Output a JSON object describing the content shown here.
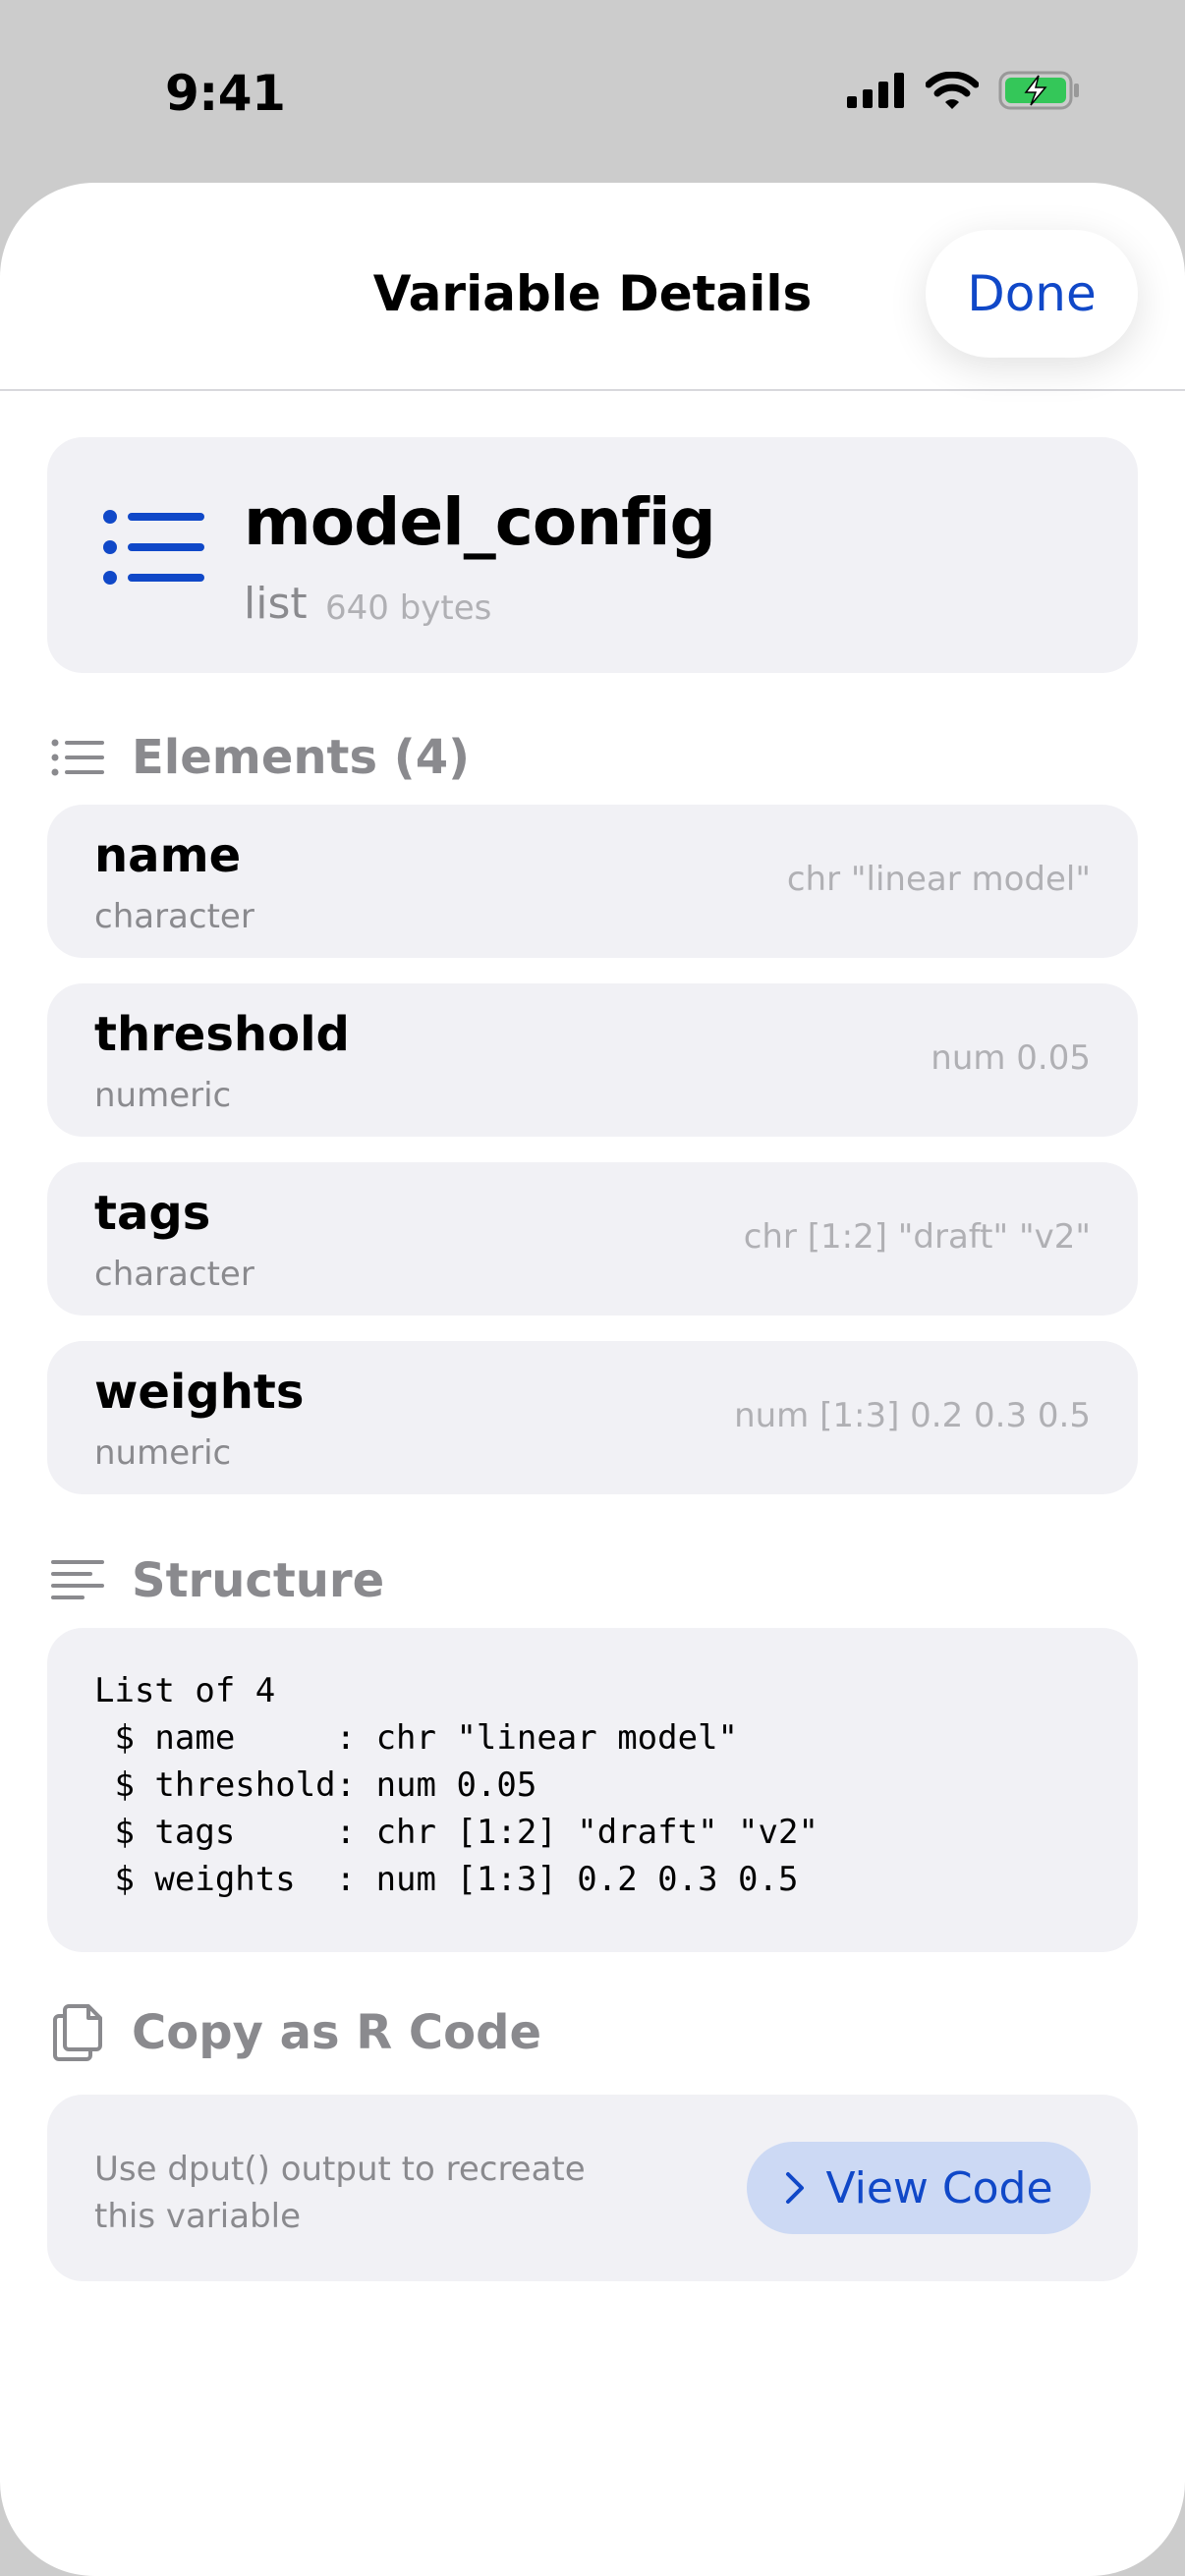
{
  "status_bar": {
    "time": "9:41"
  },
  "nav": {
    "title": "Variable Details",
    "done_label": "Done"
  },
  "variable": {
    "name": "model_config",
    "type": "list",
    "size": "640 bytes"
  },
  "elements_section": {
    "title": "Elements (4)"
  },
  "elements": [
    {
      "name": "name",
      "type": "character",
      "value": "chr \"linear model\""
    },
    {
      "name": "threshold",
      "type": "numeric",
      "value": "num 0.05"
    },
    {
      "name": "tags",
      "type": "character",
      "value": "chr [1:2] \"draft\" \"v2\""
    },
    {
      "name": "weights",
      "type": "numeric",
      "value": "num [1:3] 0.2 0.3 0.5"
    }
  ],
  "structure_section": {
    "title": "Structure",
    "lines": [
      "List of 4",
      " $ name     : chr \"linear model\"",
      " $ threshold: num 0.05",
      " $ tags     : chr [1:2] \"draft\" \"v2\"",
      " $ weights  : num [1:3] 0.2 0.3 0.5"
    ]
  },
  "copy_section": {
    "title": "Copy as R Code",
    "description_lines": [
      "Use dput() output to recreate",
      "this variable"
    ],
    "button_label": "View Code"
  },
  "colors": {
    "accent": "#1048c8",
    "card": "#f1f1f5",
    "secondary_text": "#8a8a8e"
  }
}
